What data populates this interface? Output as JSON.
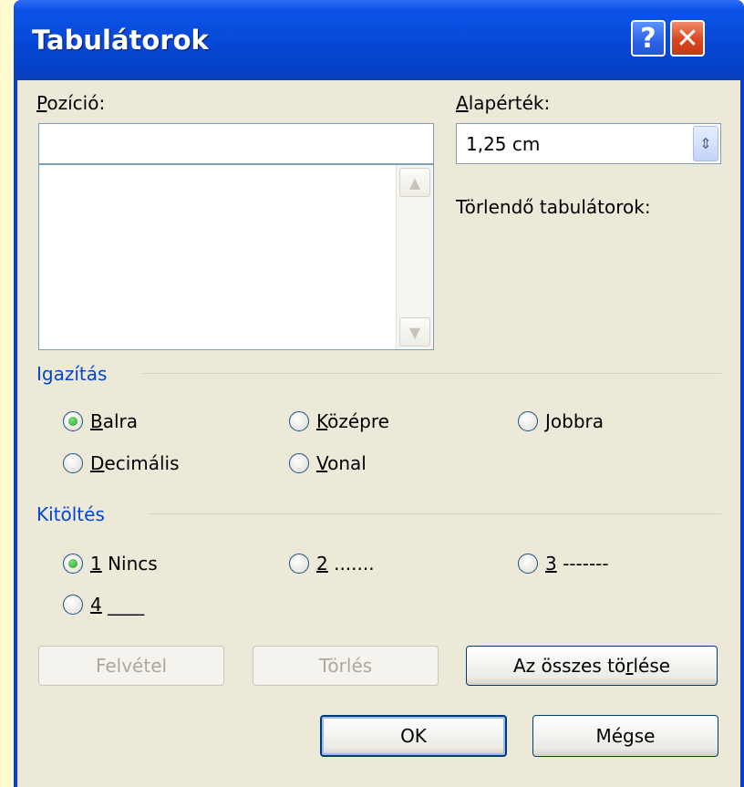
{
  "window": {
    "title": "Tabulátorok",
    "help_label": "?",
    "close_label": "✕"
  },
  "position": {
    "label": "Pozíció:",
    "value": "",
    "list_items": []
  },
  "default_tab": {
    "label": "Alapérték:",
    "value": "1,25 cm"
  },
  "clear_tabs": {
    "label": "Törlendő tabulátorok:"
  },
  "alignment": {
    "title": "Igazítás",
    "options": [
      {
        "label": "Balra",
        "checked": true
      },
      {
        "label": "Középre",
        "checked": false
      },
      {
        "label": "Jobbra",
        "checked": false
      },
      {
        "label": "Decimális",
        "checked": false
      },
      {
        "label": "Vonal",
        "checked": false
      }
    ]
  },
  "leader": {
    "title": "Kitöltés",
    "options": [
      {
        "label": "1 Nincs",
        "checked": true
      },
      {
        "label": "2 .......",
        "checked": false
      },
      {
        "label": "3 -------",
        "checked": false
      },
      {
        "label": "4 ____",
        "checked": false
      }
    ]
  },
  "buttons": {
    "set": "Felvétel",
    "clear": "Törlés",
    "clear_all": "Az összes törlése",
    "ok": "OK",
    "cancel": "Mégse"
  }
}
